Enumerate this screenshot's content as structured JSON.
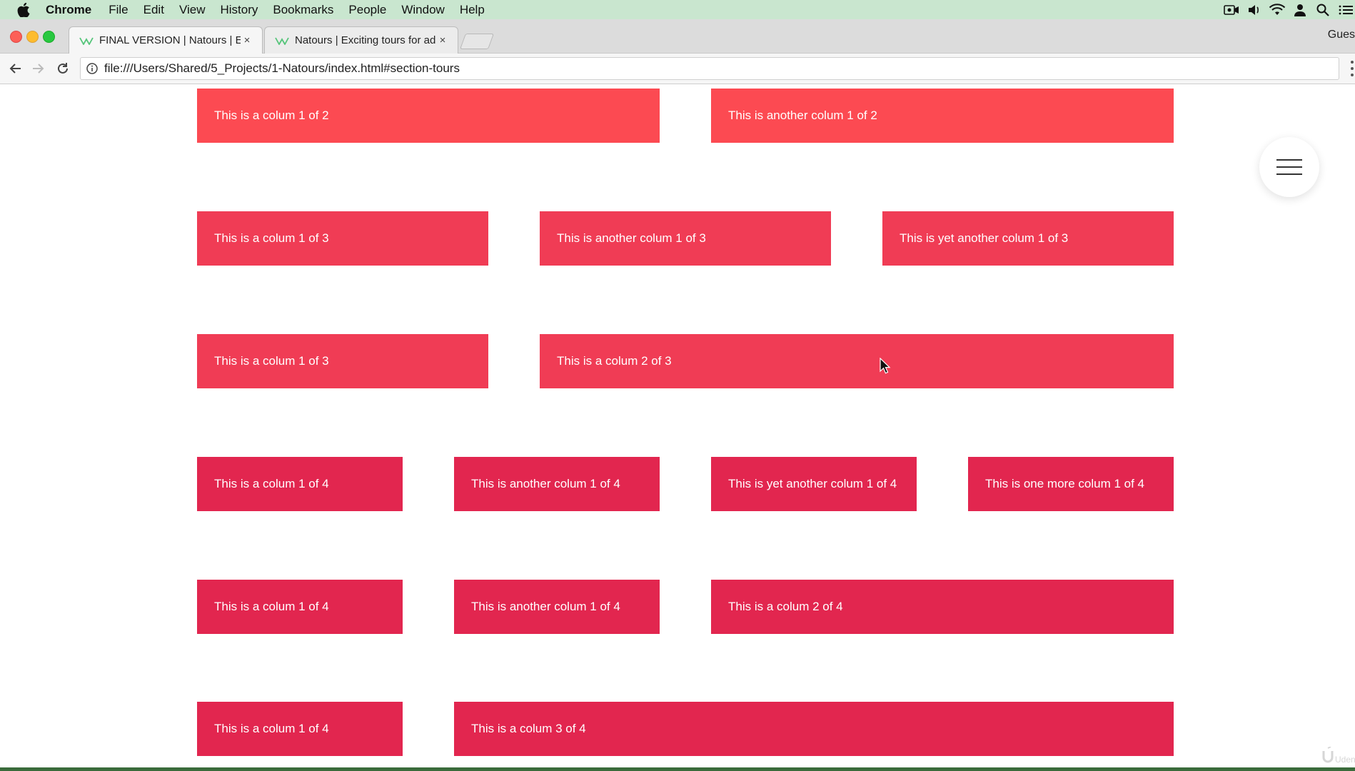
{
  "menubar": {
    "app": "Chrome",
    "items": [
      "File",
      "Edit",
      "View",
      "History",
      "Bookmarks",
      "People",
      "Window",
      "Help"
    ]
  },
  "tabs": [
    {
      "title": "FINAL VERSION | Natours | Exc",
      "close": "×"
    },
    {
      "title": "Natours | Exciting tours for ad",
      "close": "×"
    }
  ],
  "profile": "Gues",
  "url": "file:///Users/Shared/5_Projects/1-Natours/index.html#section-tours",
  "rows": [
    {
      "color": "#fc4a52",
      "cols": [
        "This is a colum 1 of 2",
        "This is another colum 1 of 2"
      ]
    },
    {
      "color": "#f03c55",
      "cols": [
        "This is a colum 1 of 3",
        "This is another colum 1 of 3",
        "This is yet another colum 1 of 3"
      ]
    },
    {
      "color": "#f03c55",
      "cols": [
        "This is a colum 1 of 3",
        "This is a colum 2 of 3"
      ]
    },
    {
      "color": "#e2264f",
      "cols": [
        "This is a colum 1 of 4",
        "This is another colum 1 of 4",
        "This is yet another colum 1 of 4",
        "This is one more colum 1 of 4"
      ]
    },
    {
      "color": "#e2264f",
      "cols": [
        "This is a colum 1 of 4",
        "This is another colum 1 of 4",
        "This is a colum 2 of 4"
      ]
    },
    {
      "color": "#e2264f",
      "cols": [
        "This is a colum 1 of 4",
        "This is a colum 3 of 4"
      ]
    }
  ],
  "watermark": "Uden"
}
